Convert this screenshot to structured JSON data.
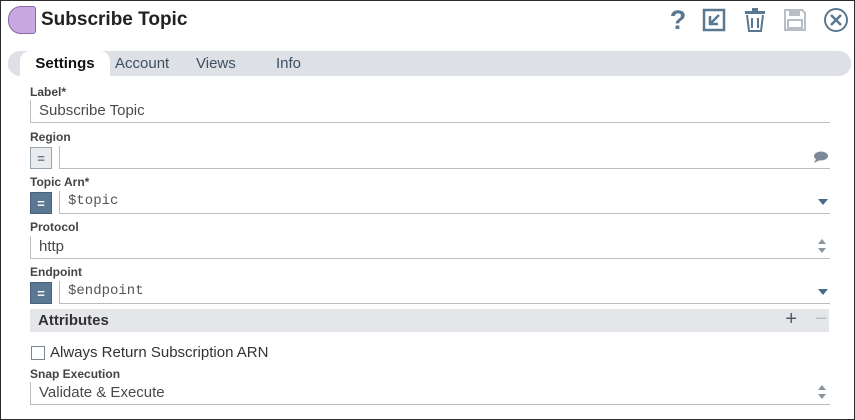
{
  "header": {
    "title": "Subscribe Topic",
    "help_glyph": "?"
  },
  "tabs": [
    {
      "label": "Settings",
      "active": true
    },
    {
      "label": "Account",
      "active": false
    },
    {
      "label": "Views",
      "active": false
    },
    {
      "label": "Info",
      "active": false
    }
  ],
  "fields": {
    "label": {
      "label": "Label*",
      "value": "Subscribe Topic"
    },
    "region": {
      "label": "Region",
      "value": "",
      "expression_enabled": false,
      "expression_glyph": "="
    },
    "topic_arn": {
      "label": "Topic Arn*",
      "value": "$topic",
      "expression_enabled": true,
      "expression_glyph": "="
    },
    "protocol": {
      "label": "Protocol",
      "value": "http"
    },
    "endpoint": {
      "label": "Endpoint",
      "value": "$endpoint",
      "expression_enabled": true,
      "expression_glyph": "="
    }
  },
  "attributes": {
    "title": "Attributes",
    "add_glyph": "+",
    "remove_glyph": "−"
  },
  "always_return_arn": {
    "label": "Always Return Subscription ARN",
    "checked": false
  },
  "snap_execution": {
    "label": "Snap Execution",
    "value": "Validate & Execute"
  },
  "colors": {
    "accent": "#5a7891",
    "snap_icon": "#c9a8e2",
    "tab_bar": "#dde0e4",
    "section_bg": "#e4e6e9"
  },
  "icons": [
    "help-icon",
    "export-icon",
    "trash-icon",
    "save-icon",
    "close-icon",
    "comment-icon",
    "dropdown-caret-icon",
    "spinner-icon"
  ]
}
